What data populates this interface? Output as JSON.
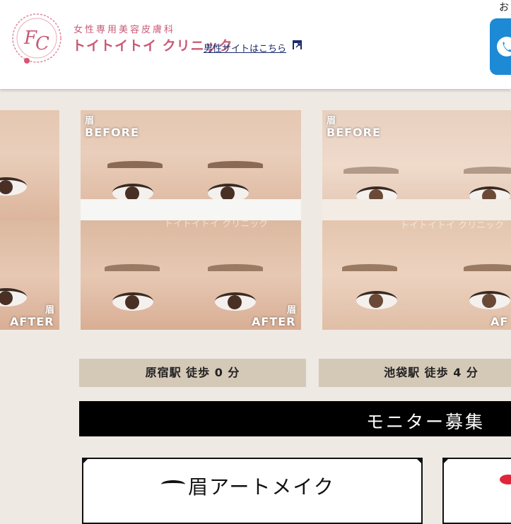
{
  "header": {
    "tagline": "女性専用美容皮膚科",
    "brand_name": "トイトイトイ クリニック",
    "male_site_link": "男性サイトはこちら",
    "top_right_text": "お"
  },
  "gallery": {
    "items": [
      {
        "part_label_top": "",
        "before_label": "",
        "part_label_bottom": "眉",
        "after_label": "AFTER"
      },
      {
        "part_label_top": "眉",
        "before_label": "BEFORE",
        "part_label_bottom": "眉",
        "after_label": "AFTER",
        "watermark": "トイトイトイ クリニック"
      },
      {
        "part_label_top": "眉",
        "before_label": "BEFORE",
        "part_label_bottom": "",
        "after_label": "AF",
        "watermark": "トイトイトイ クリニック"
      }
    ]
  },
  "stations": [
    {
      "label": "原宿駅 徒歩 0 分"
    },
    {
      "label": "池袋駅 徒歩 4 分"
    }
  ],
  "monitor": {
    "title": "モニター募集"
  },
  "cards": [
    {
      "title": "眉アートメイク"
    }
  ],
  "colors": {
    "brand_pink": "#c85a74",
    "link_navy": "#1a2a6c",
    "cta_blue": "#1c8ad4",
    "station_bg": "#d4c8b7"
  }
}
